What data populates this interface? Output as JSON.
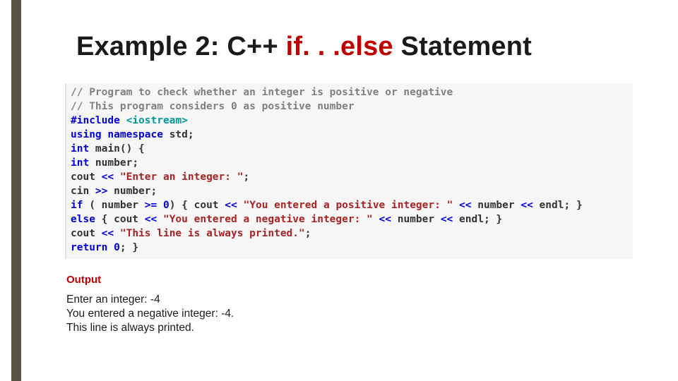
{
  "title": {
    "pre": "Example 2: C++ ",
    "kw": "if. . .else",
    "post": " Statement"
  },
  "code": {
    "l1": "// Program to check whether an integer is positive or negative",
    "l2": "// This program considers 0 as positive number",
    "l3a": "#include",
    "l3b": " <iostream>",
    "l4a": "using",
    "l4b": " namespace",
    "l4c": " std",
    "l4d": ";",
    "l5a": "int",
    "l5b": " main",
    "l5c": "() {",
    "l6a": "int",
    "l6b": " number",
    "l6c": ";",
    "l7a": "cout ",
    "l7b": "<<",
    "l7c": " ",
    "l7d": "\"Enter an integer: \"",
    "l7e": ";",
    "l8a": "cin ",
    "l8b": ">>",
    "l8c": " number",
    "l8d": ";",
    "l9a": "if",
    "l9b": " ( number ",
    "l9c": ">=",
    "l9d": " ",
    "l9e": "0",
    "l9f": ") { cout ",
    "l9g": "<<",
    "l9h": " ",
    "l9i": "\"You entered a positive integer: \"",
    "l9j": " ",
    "l9k": "<<",
    "l9l": " number ",
    "l9m": "<<",
    "l9n": " endl",
    "l9o": "; }",
    "l10a": "else",
    "l10b": " { cout ",
    "l10c": "<<",
    "l10d": " ",
    "l10e": "\"You entered a negative integer: \"",
    "l10f": " ",
    "l10g": "<<",
    "l10h": " number ",
    "l10i": "<<",
    "l10j": " endl",
    "l10k": "; }",
    "l11a": "cout ",
    "l11b": "<<",
    "l11c": " ",
    "l11d": "\"This line is always printed.\"",
    "l11e": ";",
    "l12a": "return",
    "l12b": " ",
    "l12c": "0",
    "l12d": "; }"
  },
  "output_label": "Output",
  "output_lines": "Enter an integer: -4\nYou entered a negative integer: -4.\nThis line is always printed."
}
